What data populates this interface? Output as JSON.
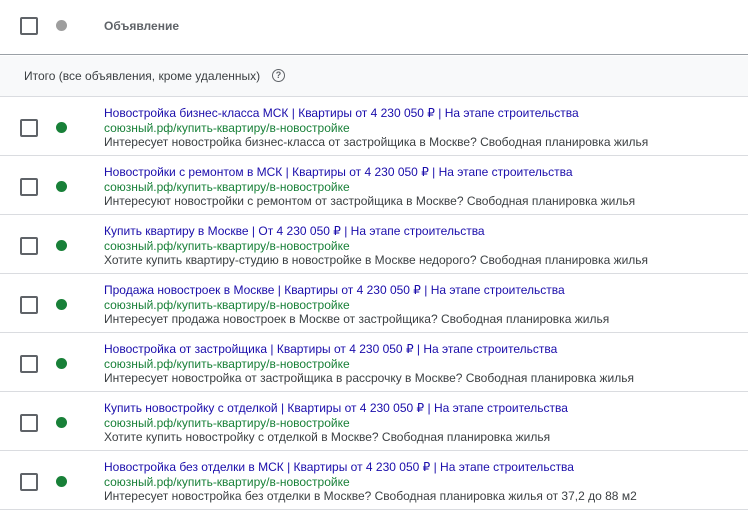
{
  "header": {
    "column_title": "Объявление"
  },
  "total": {
    "label": "Итого (все объявления, кроме удаленных)",
    "help_glyph": "?"
  },
  "ads": [
    {
      "headline": "Новостройка бизнес-класса МСК | Квартиры от 4 230 050 ₽ | На этапе строительства",
      "url": "союзный.рф/купить-квартиру/в-новостройке",
      "description": "Интересует новостройка бизнес-класса от застройщика в Москве? Свободная планировка жилья"
    },
    {
      "headline": "Новостройки с ремонтом в МСК | Квартиры от 4 230 050 ₽ | На этапе строительства",
      "url": "союзный.рф/купить-квартиру/в-новостройке",
      "description": "Интересуют новостройки с ремонтом от застройщика в Москве? Свободная планировка жилья"
    },
    {
      "headline": "Купить квартиру в Москве | От 4 230 050 ₽ | На этапе строительства",
      "url": "союзный.рф/купить-квартиру/в-новостройке",
      "description": "Хотите купить квартиру-студию в новостройке в Москве недорого? Свободная планировка жилья"
    },
    {
      "headline": "Продажа новостроек в Москве | Квартиры от 4 230 050 ₽ | На этапе строительства",
      "url": "союзный.рф/купить-квартиру/в-новостройке",
      "description": "Интересует продажа новостроек в Москве от застройщика? Свободная планировка жилья"
    },
    {
      "headline": "Новостройка от застройщика | Квартиры от 4 230 050 ₽ | На этапе строительства",
      "url": "союзный.рф/купить-квартиру/в-новостройке",
      "description": "Интересует новостройка от застройщика в рассрочку в Москве? Свободная планировка жилья"
    },
    {
      "headline": "Купить новостройку с отделкой | Квартиры от 4 230 050 ₽ | На этапе строительства",
      "url": "союзный.рф/купить-квартиру/в-новостройке",
      "description": "Хотите купить новостройку с отделкой в Москве? Свободная планировка жилья"
    },
    {
      "headline": "Новостройка без отделки в МСК | Квартиры от 4 230 050 ₽ | На этапе строительства",
      "url": "союзный.рф/купить-квартиру/в-новостройке",
      "description": "Интересует новостройка без отделки в Москве? Свободная планировка жилья от 37,2 до 88 м2"
    }
  ],
  "colors": {
    "status_enabled": "#188038",
    "status_header": "#9e9e9e",
    "headline_link": "#1a0dab",
    "url_green": "#188038"
  }
}
